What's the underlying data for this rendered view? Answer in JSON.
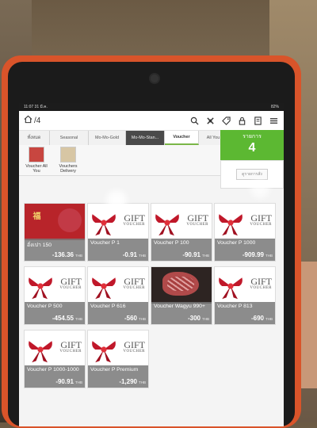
{
  "status": {
    "time": "11:07",
    "date": "31 มี.ค.",
    "battery": "82%"
  },
  "toolbar": {
    "table_number": "/4"
  },
  "tabs": [
    {
      "label": "ทั้งหมด"
    },
    {
      "label": "Seasonal"
    },
    {
      "label": "Mo-Mo-Gold"
    },
    {
      "label": "Mo-Mo-Stan..."
    },
    {
      "label": "Voucher"
    },
    {
      "label": "All You"
    }
  ],
  "total": {
    "label": "รายการ",
    "count": "4",
    "view_label": "ดูรายการสั่ง"
  },
  "categories": [
    {
      "label": "Voucher All You"
    },
    {
      "label": "Vouchers Delivery"
    }
  ],
  "gift_art": {
    "line1": "GIFT",
    "line2": "VOUCHER"
  },
  "currency": "THB",
  "cards": [
    {
      "name": "อั่งเปา 150",
      "price": "-136.36"
    },
    {
      "name": "Voucher P 1",
      "price": "-0.91"
    },
    {
      "name": "Voucher P 100",
      "price": "-90.91"
    },
    {
      "name": "Voucher P 1000",
      "price": "-909.99"
    },
    {
      "name": "Voucher P 500",
      "price": "-454.55"
    },
    {
      "name": "Voucher P 616",
      "price": "-560"
    },
    {
      "name": "Voucher Wagyu 990+",
      "price": "-300"
    },
    {
      "name": "Voucher P 813",
      "price": "-690"
    },
    {
      "name": "Voucher P 1000-1000",
      "price": "-90.91"
    },
    {
      "name": "Voucher P Premium",
      "price": "-1,290"
    }
  ],
  "colors": {
    "case": "#d9542a",
    "accent_green": "#5cb832",
    "card_footer": "#787878",
    "bow_red": "#c0182a"
  }
}
